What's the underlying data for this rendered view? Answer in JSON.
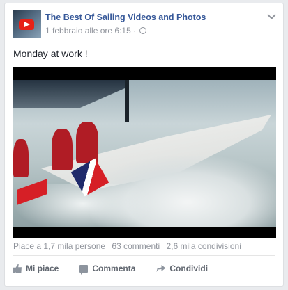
{
  "post": {
    "page_name": "The Best Of Sailing Videos and Photos",
    "timestamp": "1 febbraio alle ore 6:15",
    "separator": "·",
    "text": "Monday at work !"
  },
  "stats": {
    "likes": "Piace a 1,7 mila persone",
    "comments": "63 commenti",
    "shares": "2,6 mila condivisioni"
  },
  "actions": {
    "like": "Mi piace",
    "comment": "Commenta",
    "share": "Condividi"
  },
  "colors": {
    "page_name": "#365899",
    "meta": "#90949c",
    "action_text": "#616770",
    "youtube_red": "#e62117"
  },
  "icons": [
    "youtube-icon",
    "globe-icon",
    "chevron-down-icon",
    "like-icon",
    "comment-icon",
    "share-icon"
  ]
}
